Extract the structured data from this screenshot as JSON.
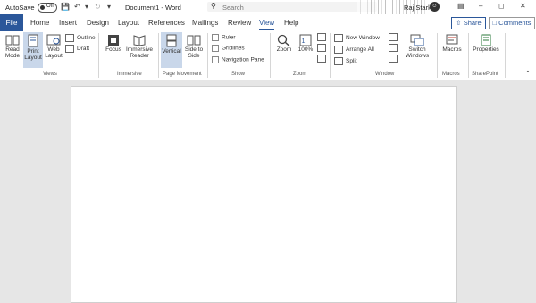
{
  "titlebar": {
    "autosave_label": "AutoSave",
    "autosave_state": "Off",
    "doc_title": "Document1 - Word",
    "search_placeholder": "Search",
    "user_name": "Raj Stark"
  },
  "tabs": [
    "File",
    "Home",
    "Insert",
    "Design",
    "Layout",
    "References",
    "Mailings",
    "Review",
    "View",
    "Help"
  ],
  "active_tab": "View",
  "header_buttons": {
    "share": "Share",
    "comments": "Comments"
  },
  "ribbon": {
    "views": {
      "group_label": "Views",
      "read_mode": "Read Mode",
      "print_layout": "Print Layout",
      "web_layout": "Web Layout",
      "outline": "Outline",
      "draft": "Draft"
    },
    "immersive": {
      "group_label": "Immersive",
      "focus": "Focus",
      "immersive_reader": "Immersive Reader"
    },
    "page_movement": {
      "group_label": "Page Movement",
      "vertical": "Vertical",
      "side_to_side": "Side to Side"
    },
    "show": {
      "group_label": "Show",
      "ruler": "Ruler",
      "gridlines": "Gridlines",
      "navigation_pane": "Navigation Pane"
    },
    "zoom": {
      "group_label": "Zoom",
      "zoom": "Zoom",
      "percent": "100%"
    },
    "window": {
      "group_label": "Window",
      "new_window": "New Window",
      "arrange_all": "Arrange All",
      "split": "Split",
      "switch_windows": "Switch Windows"
    },
    "macros": {
      "group_label": "Macros",
      "macros": "Macros"
    },
    "sharepoint": {
      "group_label": "SharePoint",
      "properties": "Properties"
    }
  },
  "colors": {
    "accent": "#2b579a",
    "pressed": "#c9d7ea"
  }
}
